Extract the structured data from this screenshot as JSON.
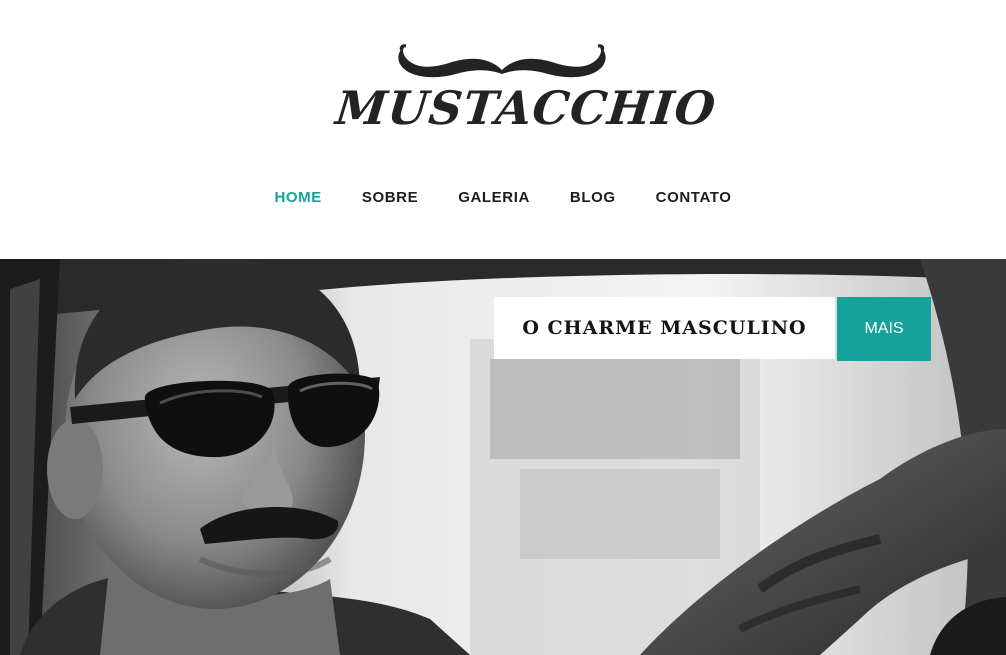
{
  "brand": {
    "name": "MUSTACCHIO",
    "logo_icon": "mustache-icon"
  },
  "nav": {
    "items": [
      {
        "label": "HOME",
        "active": true
      },
      {
        "label": "SOBRE",
        "active": false
      },
      {
        "label": "GALERIA",
        "active": false
      },
      {
        "label": "BLOG",
        "active": false
      },
      {
        "label": "CONTATO",
        "active": false
      }
    ]
  },
  "hero": {
    "caption": "O CHARME MASCULINO",
    "button_label": "MAIS",
    "image": "man-with-sunglasses-driving-car"
  },
  "colors": {
    "accent": "#16a29c",
    "text": "#1d1d1d",
    "background": "#ffffff"
  }
}
